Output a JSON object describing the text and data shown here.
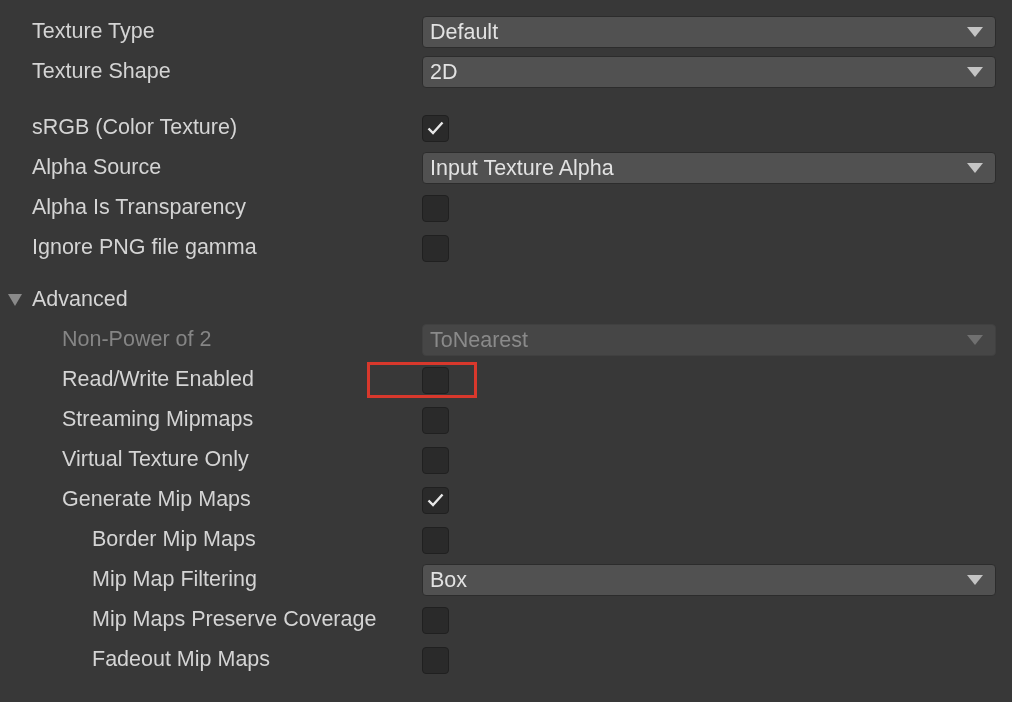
{
  "groups": [
    [
      {
        "kind": "dropdown",
        "label": "Texture Type",
        "value": "Default",
        "disabled": false
      },
      {
        "kind": "dropdown",
        "label": "Texture Shape",
        "value": "2D",
        "disabled": false
      }
    ],
    [
      {
        "kind": "checkbox",
        "label": "sRGB (Color Texture)",
        "checked": true
      },
      {
        "kind": "dropdown",
        "label": "Alpha Source",
        "value": "Input Texture Alpha",
        "disabled": false
      },
      {
        "kind": "checkbox",
        "label": "Alpha Is Transparency",
        "checked": false
      },
      {
        "kind": "checkbox",
        "label": "Ignore PNG file gamma",
        "checked": false
      },
      {
        "kind": "foldout",
        "label": "Advanced",
        "expanded": true,
        "children": [
          {
            "kind": "dropdown",
            "label": "Non-Power of 2",
            "value": "ToNearest",
            "disabled": true
          },
          {
            "kind": "checkbox",
            "label": "Read/Write Enabled",
            "checked": false,
            "highlighted": true
          },
          {
            "kind": "checkbox",
            "label": "Streaming Mipmaps",
            "checked": false
          },
          {
            "kind": "checkbox",
            "label": "Virtual Texture Only",
            "checked": false
          },
          {
            "kind": "checkbox",
            "label": "Generate Mip Maps",
            "checked": true,
            "children": [
              {
                "kind": "checkbox",
                "label": "Border Mip Maps",
                "checked": false
              },
              {
                "kind": "dropdown",
                "label": "Mip Map Filtering",
                "value": "Box",
                "disabled": false
              },
              {
                "kind": "checkbox",
                "label": "Mip Maps Preserve Coverage",
                "checked": false
              },
              {
                "kind": "checkbox",
                "label": "Fadeout Mip Maps",
                "checked": false
              }
            ]
          }
        ]
      }
    ]
  ]
}
